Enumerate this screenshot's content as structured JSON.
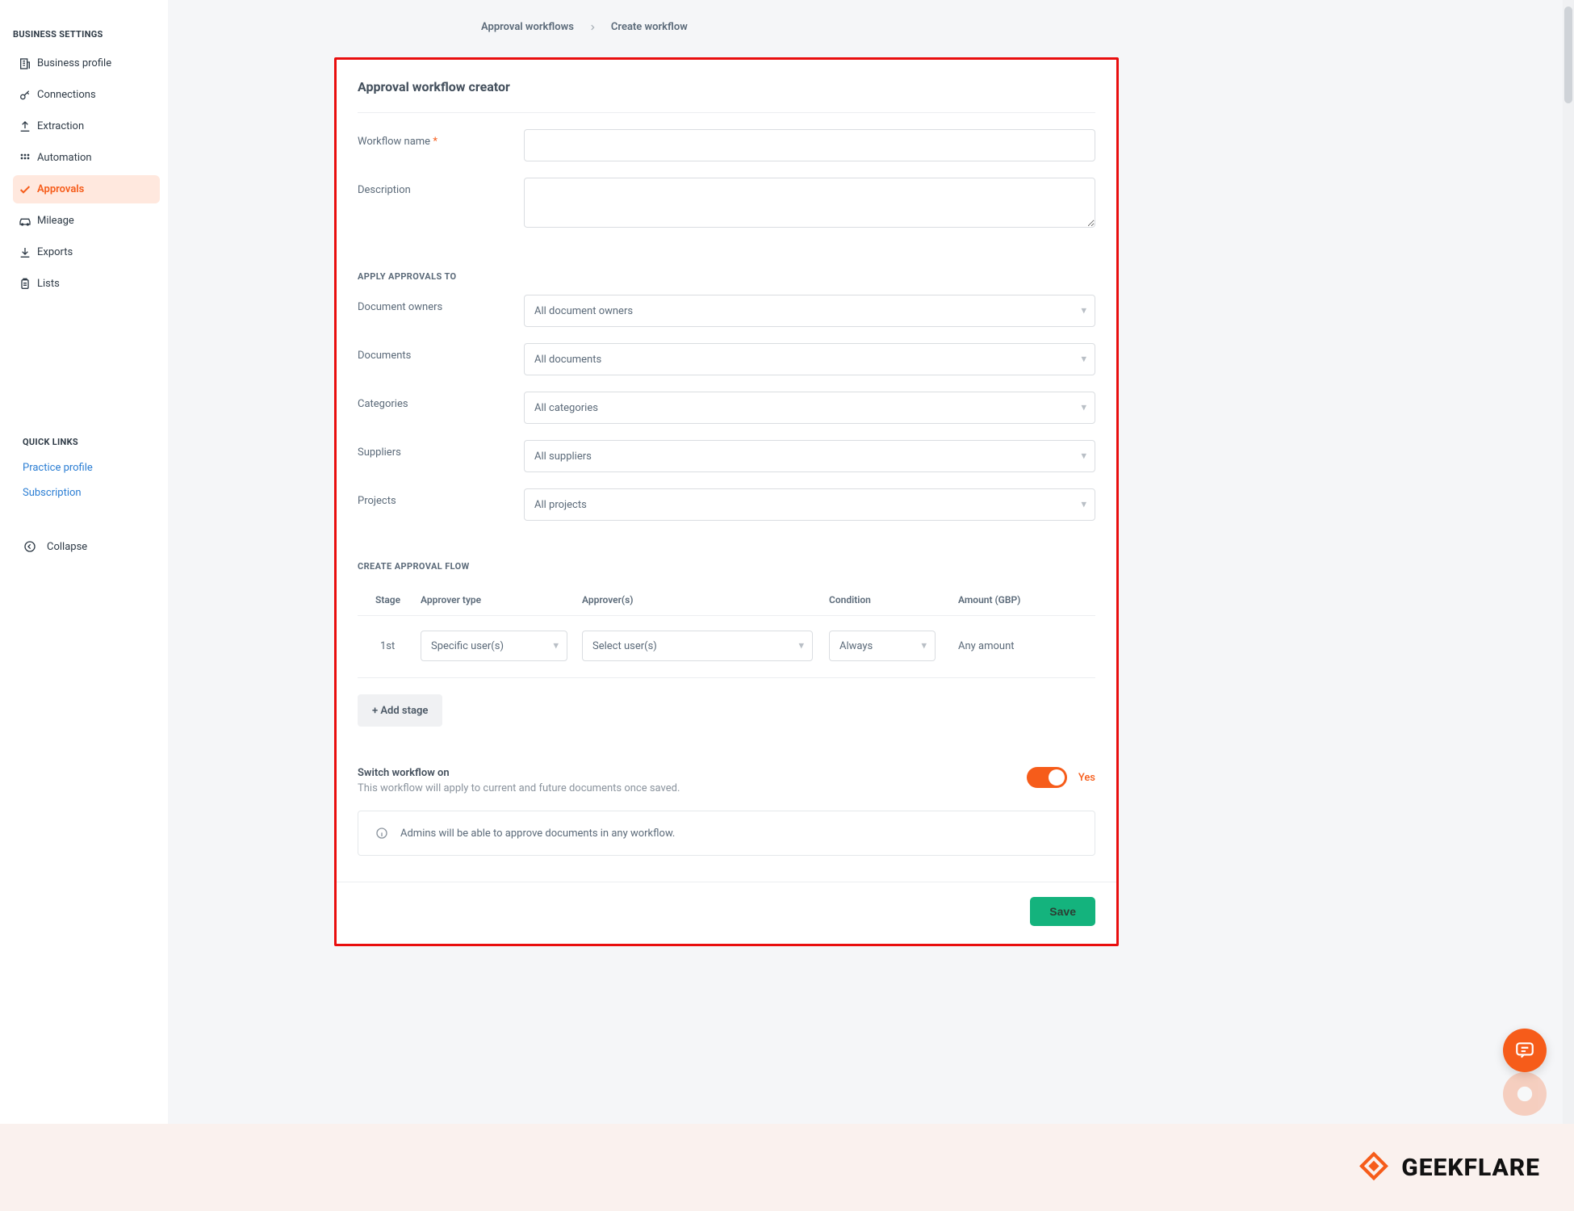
{
  "colors": {
    "accent": "#f65c1a",
    "success": "#14b37d",
    "highlight_border": "#e90e0e"
  },
  "sidebar": {
    "heading": "BUSINESS SETTINGS",
    "items": [
      {
        "label": "Business profile",
        "icon": "building"
      },
      {
        "label": "Connections",
        "icon": "key"
      },
      {
        "label": "Extraction",
        "icon": "upload"
      },
      {
        "label": "Automation",
        "icon": "grid-dots"
      },
      {
        "label": "Approvals",
        "icon": "check",
        "active": true
      },
      {
        "label": "Mileage",
        "icon": "car"
      },
      {
        "label": "Exports",
        "icon": "download"
      },
      {
        "label": "Lists",
        "icon": "clipboard"
      }
    ],
    "quick_links_heading": "QUICK LINKS",
    "quick_links": [
      {
        "label": "Practice profile"
      },
      {
        "label": "Subscription"
      }
    ],
    "collapse_label": "Collapse"
  },
  "breadcrumb": {
    "items": [
      "Approval workflows",
      "Create workflow"
    ]
  },
  "panel": {
    "title": "Approval workflow creator",
    "fields": {
      "workflow_name_label": "Workflow name",
      "workflow_name_value": "",
      "description_label": "Description",
      "description_value": ""
    },
    "apply_heading": "APPLY APPROVALS TO",
    "apply_rows": [
      {
        "label": "Document owners",
        "value": "All document owners"
      },
      {
        "label": "Documents",
        "value": "All documents"
      },
      {
        "label": "Categories",
        "value": "All categories"
      },
      {
        "label": "Suppliers",
        "value": "All suppliers"
      },
      {
        "label": "Projects",
        "value": "All projects"
      }
    ],
    "flow_heading": "CREATE APPROVAL FLOW",
    "flow_columns": {
      "stage": "Stage",
      "type": "Approver type",
      "approvers": "Approver(s)",
      "condition": "Condition",
      "amount": "Amount (GBP)"
    },
    "flow_rows": [
      {
        "stage": "1st",
        "type": "Specific user(s)",
        "approvers": "Select user(s)",
        "condition": "Always",
        "amount": "Any amount"
      }
    ],
    "add_stage_label": "+ Add stage",
    "switch": {
      "title": "Switch workflow on",
      "desc": "This workflow will apply to current and future documents once saved.",
      "state_label": "Yes",
      "on": true
    },
    "info_note": "Admins will be able to approve documents in any workflow.",
    "save_label": "Save"
  },
  "brand": {
    "name": "GEEKFLARE"
  }
}
